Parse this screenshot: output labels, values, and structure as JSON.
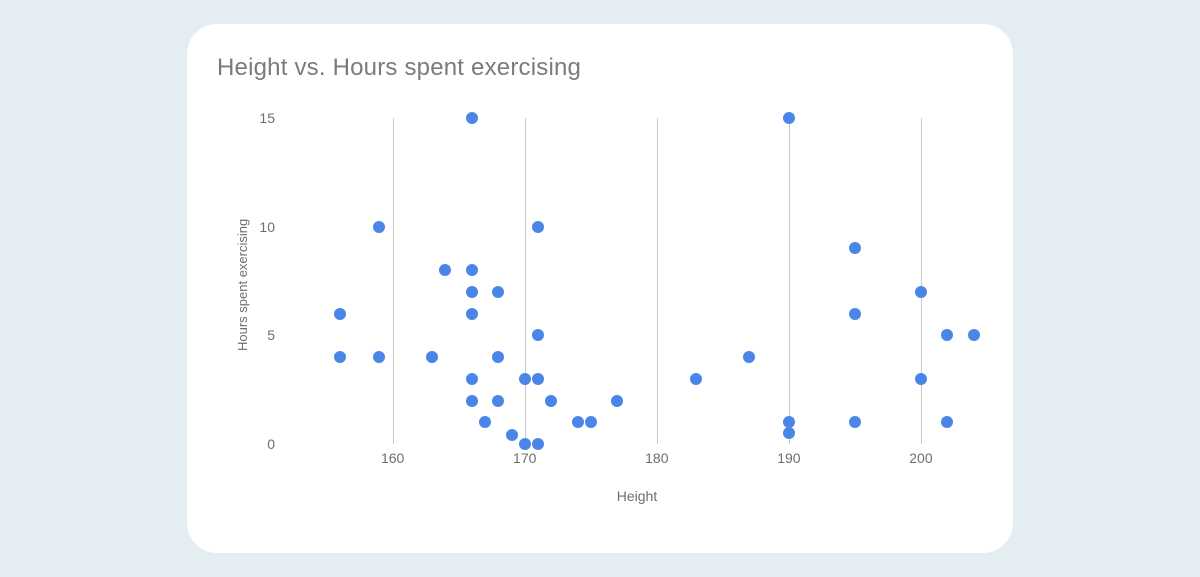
{
  "chart_data": {
    "type": "scatter",
    "title": "Height vs. Hours spent exercising",
    "xlabel": "Height",
    "ylabel": "Hours spent exercising",
    "xlim": [
      152,
      205
    ],
    "ylim": [
      0,
      15
    ],
    "x_ticks": [
      160,
      170,
      180,
      190,
      200
    ],
    "y_ticks": [
      0,
      5,
      10,
      15
    ],
    "points": [
      {
        "x": 156,
        "y": 4
      },
      {
        "x": 156,
        "y": 6
      },
      {
        "x": 159,
        "y": 4
      },
      {
        "x": 159,
        "y": 10
      },
      {
        "x": 163,
        "y": 4
      },
      {
        "x": 164,
        "y": 8
      },
      {
        "x": 166,
        "y": 2
      },
      {
        "x": 166,
        "y": 3
      },
      {
        "x": 166,
        "y": 6
      },
      {
        "x": 166,
        "y": 7
      },
      {
        "x": 166,
        "y": 8
      },
      {
        "x": 166,
        "y": 15
      },
      {
        "x": 167,
        "y": 1
      },
      {
        "x": 168,
        "y": 2
      },
      {
        "x": 168,
        "y": 4
      },
      {
        "x": 168,
        "y": 7
      },
      {
        "x": 169,
        "y": 0.4
      },
      {
        "x": 170,
        "y": 0
      },
      {
        "x": 170,
        "y": 3
      },
      {
        "x": 171,
        "y": 0
      },
      {
        "x": 171,
        "y": 3
      },
      {
        "x": 171,
        "y": 5
      },
      {
        "x": 171,
        "y": 10
      },
      {
        "x": 172,
        "y": 2
      },
      {
        "x": 174,
        "y": 1
      },
      {
        "x": 175,
        "y": 1
      },
      {
        "x": 177,
        "y": 2
      },
      {
        "x": 183,
        "y": 3
      },
      {
        "x": 187,
        "y": 4
      },
      {
        "x": 190,
        "y": 0.5
      },
      {
        "x": 190,
        "y": 1
      },
      {
        "x": 190,
        "y": 15
      },
      {
        "x": 195,
        "y": 1
      },
      {
        "x": 195,
        "y": 6
      },
      {
        "x": 195,
        "y": 9
      },
      {
        "x": 200,
        "y": 3
      },
      {
        "x": 200,
        "y": 7
      },
      {
        "x": 202,
        "y": 1
      },
      {
        "x": 202,
        "y": 5
      },
      {
        "x": 204,
        "y": 5
      }
    ]
  }
}
